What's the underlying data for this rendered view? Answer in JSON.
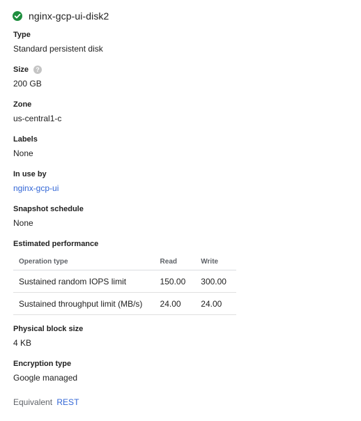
{
  "header": {
    "title": "nginx-gcp-ui-disk2",
    "status_icon": "check-circle-icon",
    "status_color": "#1e8e3e"
  },
  "fields": {
    "type": {
      "label": "Type",
      "value": "Standard persistent disk"
    },
    "size": {
      "label": "Size",
      "value": "200 GB",
      "help_icon": "?"
    },
    "zone": {
      "label": "Zone",
      "value": "us-central1-c"
    },
    "labels": {
      "label": "Labels",
      "value": "None"
    },
    "in_use_by": {
      "label": "In use by",
      "value": "nginx-gcp-ui"
    },
    "snapshot_schedule": {
      "label": "Snapshot schedule",
      "value": "None"
    },
    "physical_block_size": {
      "label": "Physical block size",
      "value": "4 KB"
    },
    "encryption_type": {
      "label": "Encryption type",
      "value": "Google managed"
    }
  },
  "performance": {
    "label": "Estimated performance",
    "headers": [
      "Operation type",
      "Read",
      "Write"
    ],
    "rows": [
      [
        "Sustained random IOPS limit",
        "150.00",
        "300.00"
      ],
      [
        "Sustained throughput limit (MB/s)",
        "24.00",
        "24.00"
      ]
    ]
  },
  "footer": {
    "prefix": "Equivalent",
    "link": "REST"
  },
  "colors": {
    "link": "#3367d6",
    "text": "#212121",
    "muted": "#5f6368"
  }
}
